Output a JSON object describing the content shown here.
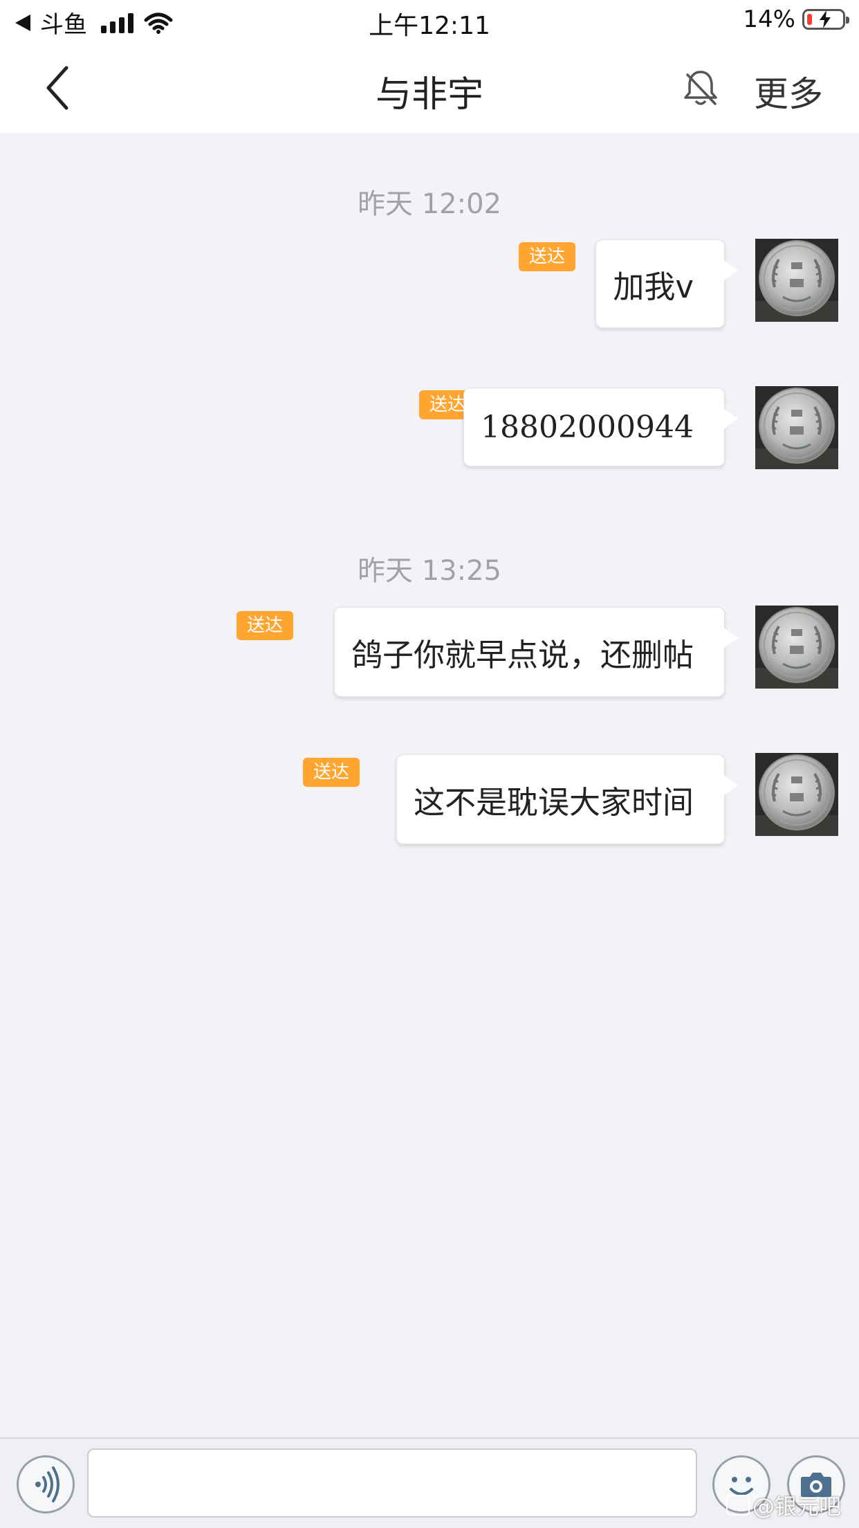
{
  "status_bar": {
    "back_app": "斗鱼",
    "time": "上午12:11",
    "battery_percent": "14%",
    "battery_level": 0.14,
    "low_battery_color": "#ff3b30"
  },
  "nav": {
    "title": "与非宇",
    "more": "更多",
    "icons": {
      "back": "chevron-left-icon",
      "mute": "bell-slash-icon"
    }
  },
  "messages": [
    {
      "type": "timestamp",
      "text": "昨天 12:02"
    },
    {
      "type": "sent",
      "text": "加我v",
      "status": "送达"
    },
    {
      "type": "sent",
      "text": "18802000944",
      "status": "送达"
    },
    {
      "type": "timestamp",
      "text": "昨天 13:25"
    },
    {
      "type": "sent",
      "text": "鸽子你就早点说，还删帖",
      "status": "送达"
    },
    {
      "type": "sent",
      "text": "这不是耽误大家时间",
      "status": "送达"
    }
  ],
  "input_bar": {
    "icons": {
      "voice": "voice-wave-icon",
      "emoji": "smiley-icon",
      "camera": "camera-icon"
    }
  },
  "watermark": "@银元吧",
  "colors": {
    "badge": "#ffa530",
    "chat_background": "#f3f3f7",
    "timestamp_text": "#a1a1a6"
  }
}
